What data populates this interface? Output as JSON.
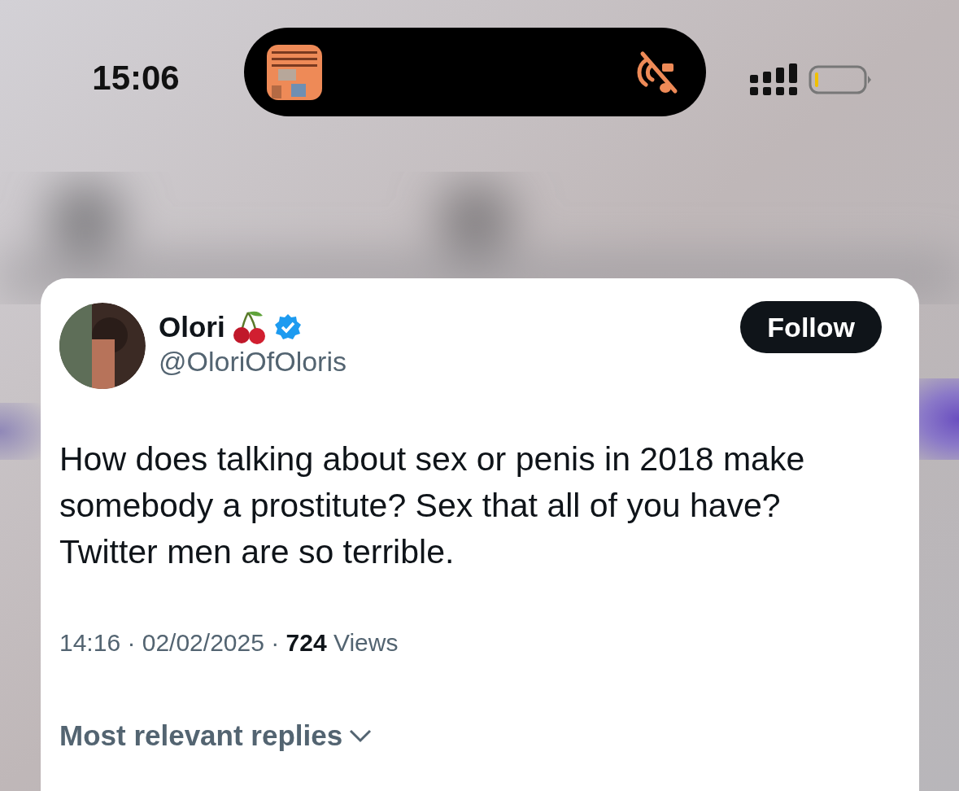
{
  "status_bar": {
    "time": "15:06"
  },
  "post": {
    "author": {
      "name": "Olori",
      "verified": true
    },
    "handle": "@OloriOfOloris",
    "follow_button": "Follow",
    "text": "How does talking about sex or penis in 2018 make somebody a prostitute? Sex that all of you have? Twitter men are so terrible.",
    "meta": "14:16 · 02/02/2025 · **724** Views",
    "replies_sort": "Most relevant replies"
  }
}
